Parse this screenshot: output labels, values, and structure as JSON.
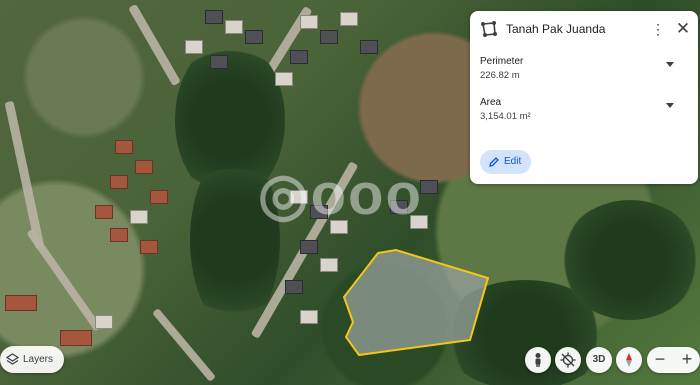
{
  "place_card": {
    "title": "Tanah Pak Juanda",
    "perimeter_label": "Perimeter",
    "perimeter_value": "226.82 m",
    "area_label": "Area",
    "area_value": "3,154.01 m²",
    "edit_label": "Edit"
  },
  "map_controls": {
    "layers_label": "Layers",
    "mode_3d_label": "3D",
    "zoom_out_symbol": "−",
    "zoom_in_symbol": "+"
  },
  "icons": {
    "shape": "polygon-icon",
    "more": "more-vert-icon",
    "close": "close-icon",
    "edit": "pencil-icon",
    "layers": "layers-icon",
    "pegman": "person-icon",
    "location": "location-disabled-icon",
    "compass": "compass-icon"
  },
  "colors": {
    "parcel_outline": "#f5c518",
    "edit_button_bg": "#d3e3fd",
    "edit_button_text": "#0b57d0"
  }
}
